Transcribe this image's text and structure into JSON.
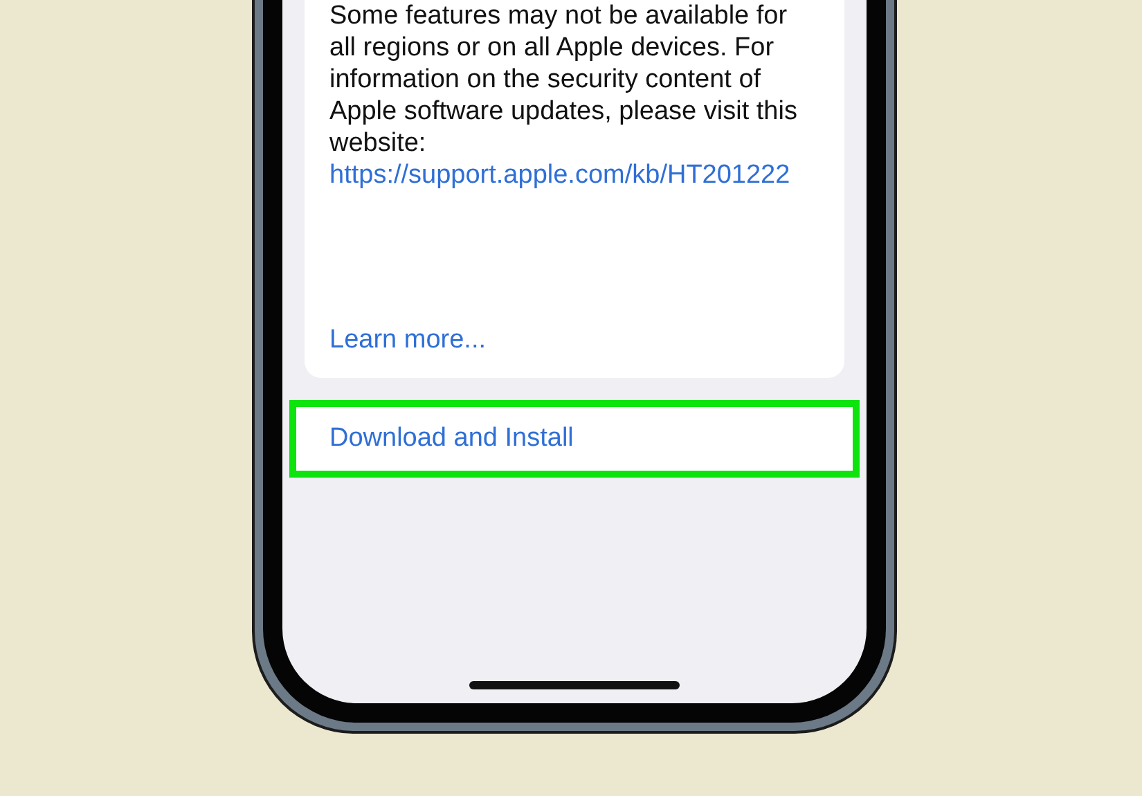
{
  "update_notes": {
    "description": "Some features may not be available for all regions or on all Apple devices. For information on the security content of Apple software updates, please visit this website:",
    "link": "https://support.apple.com/kb/HT201222",
    "learn_more": "Learn more..."
  },
  "action": {
    "label": "Download and Install",
    "highlighted": true
  }
}
